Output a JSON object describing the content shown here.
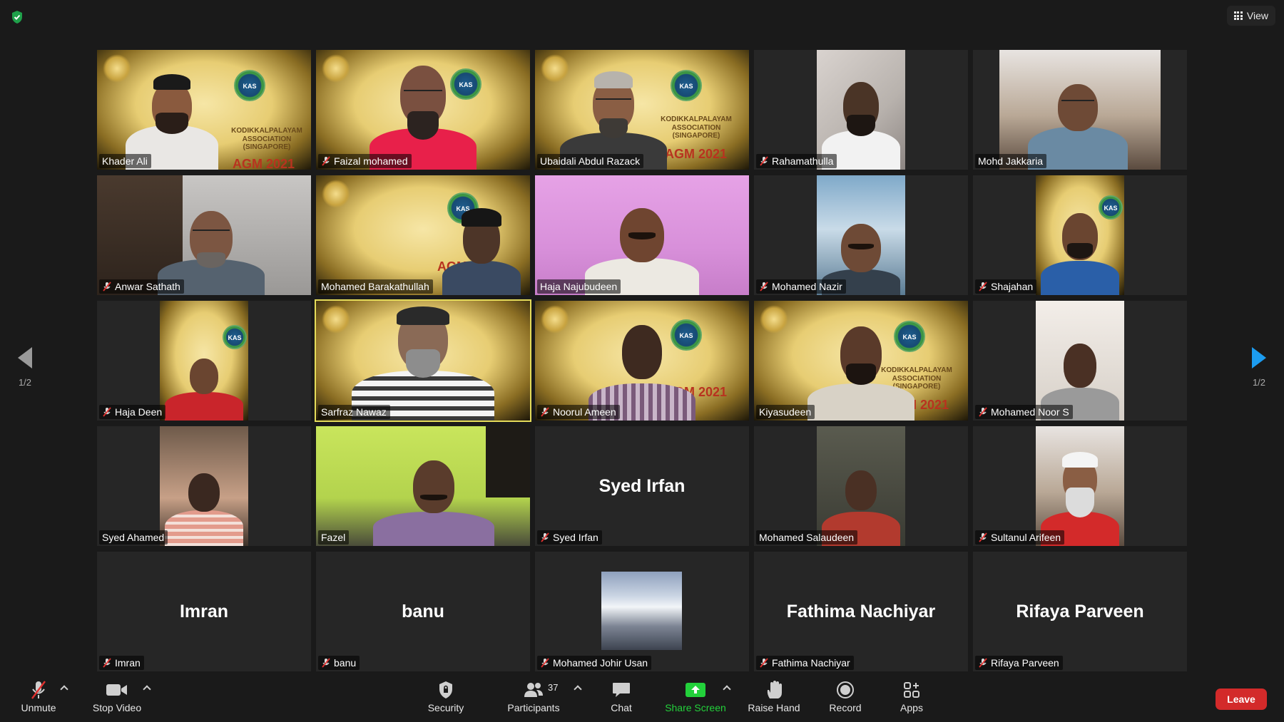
{
  "top": {
    "view_label": "View"
  },
  "pager": {
    "left_label": "1/2",
    "right_label": "1/2"
  },
  "tiles": [
    {
      "name": "Khader Ali",
      "muted": false
    },
    {
      "name": "Faizal mohamed",
      "muted": true
    },
    {
      "name": "Ubaidali Abdul Razack",
      "muted": false
    },
    {
      "name": "Rahamathulla",
      "muted": true
    },
    {
      "name": "Mohd Jakkaria",
      "muted": false
    },
    {
      "name": "Anwar Sathath",
      "muted": true
    },
    {
      "name": "Mohamed Barakathullah",
      "muted": false
    },
    {
      "name": "Haja Najubudeen",
      "muted": false
    },
    {
      "name": "Mohamed Nazir",
      "muted": true
    },
    {
      "name": "Shajahan",
      "muted": true
    },
    {
      "name": "Haja Deen",
      "muted": true
    },
    {
      "name": "Sarfraz Nawaz",
      "muted": false
    },
    {
      "name": "Noorul Ameen",
      "muted": true
    },
    {
      "name": "Kiyasudeen",
      "muted": false
    },
    {
      "name": "Mohamed Noor S",
      "muted": true
    },
    {
      "name": "Syed Ahamed",
      "muted": false
    },
    {
      "name": "Fazel",
      "muted": false
    },
    {
      "name": "Syed Irfan",
      "muted": true,
      "display_name": "Syed Irfan"
    },
    {
      "name": "Mohamed Salaudeen",
      "muted": false
    },
    {
      "name": "Sultanul Arifeen",
      "muted": true
    },
    {
      "name": "Imran",
      "muted": true,
      "display_name": "Imran"
    },
    {
      "name": "banu",
      "muted": true,
      "display_name": "banu"
    },
    {
      "name": "Mohamed Johir Usan",
      "muted": true
    },
    {
      "name": "Fathima Nachiyar",
      "muted": true,
      "display_name": "Fathima Nachiyar"
    },
    {
      "name": "Rifaya Parveen",
      "muted": true,
      "display_name": "Rifaya Parveen"
    }
  ],
  "agm_banner": {
    "org_line1": "KODIKKALPALAYAM",
    "org_line2": "ASSOCIATION",
    "org_line3": "(SINGAPORE)",
    "event": "AGM 2021",
    "logo_text": "KAS"
  },
  "toolbar": {
    "unmute": "Unmute",
    "stop_video": "Stop Video",
    "security": "Security",
    "participants": "Participants",
    "participants_count": "37",
    "chat": "Chat",
    "share_screen": "Share Screen",
    "raise_hand": "Raise Hand",
    "record": "Record",
    "apps": "Apps",
    "leave": "Leave"
  },
  "colors": {
    "background": "#1a1a1a",
    "tile": "#262626",
    "active_speaker": "#e5dc5a",
    "share_green": "#23d13b",
    "leave_red": "#d32a2a",
    "pager_blue": "#1c9cf0"
  }
}
